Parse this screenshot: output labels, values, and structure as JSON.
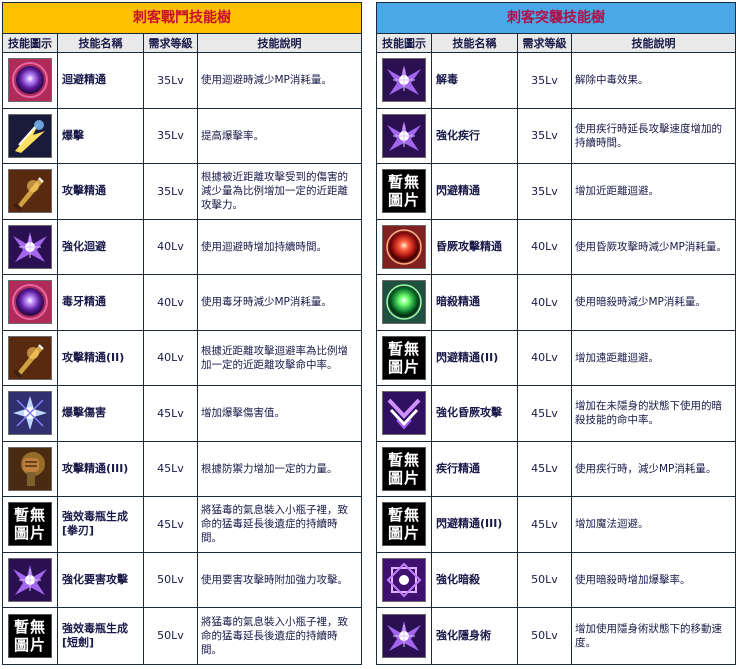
{
  "left": {
    "title": "刺客戰鬥技能樹",
    "headers": {
      "icon": "技能圖示",
      "name": "技能名稱",
      "level": "需求等級",
      "desc": "技能說明"
    },
    "rows": [
      {
        "icon": "purple-orb-icon",
        "name": "迴避精通",
        "level": "35Lv",
        "desc": "使用迴避時減少MP消耗量。"
      },
      {
        "icon": "lightning-strike-icon",
        "name": "爆擊",
        "level": "35Lv",
        "desc": "提高爆擊率。"
      },
      {
        "icon": "glowing-blade-icon",
        "name": "攻擊精通",
        "level": "35Lv",
        "desc": "根據被近距離攻擊受到的傷害的減少量為比例增加一定的近距離攻擊力。"
      },
      {
        "icon": "purple-wings-icon",
        "name": "強化迴避",
        "level": "40Lv",
        "desc": "使用迴避時增加持續時間。"
      },
      {
        "icon": "purple-orb-icon",
        "name": "毒牙精通",
        "level": "40Lv",
        "desc": "使用毒牙時減少MP消耗量。"
      },
      {
        "icon": "glowing-blade-icon",
        "name": "攻擊精通(II)",
        "level": "40Lv",
        "desc": "根據近距離攻擊迴避率為比例增加一定的近距離攻擊命中率。"
      },
      {
        "icon": "blue-burst-icon",
        "name": "爆擊傷害",
        "level": "45Lv",
        "desc": "增加爆擊傷害值。"
      },
      {
        "icon": "fist-icon",
        "name": "攻擊精通(III)",
        "level": "45Lv",
        "desc": "根據防禦力增加一定的力量。"
      },
      {
        "icon": "no-image",
        "noimg": "暫無圖片",
        "name": "強效毒瓶生成[拳刃]",
        "level": "45Lv",
        "desc": "將猛毒的氣息裝入小瓶子裡，致命的猛毒延長後遺症的持續時間。"
      },
      {
        "icon": "purple-wings-icon",
        "name": "強化要害攻擊",
        "level": "50Lv",
        "desc": "使用要害攻擊時附加強力攻擊。"
      },
      {
        "icon": "no-image",
        "noimg": "暫無圖片",
        "name": "強效毒瓶生成[短劍]",
        "level": "50Lv",
        "desc": "將猛毒的氣息裝入小瓶子裡，致命的猛毒延長後遺症的持續時間。"
      }
    ]
  },
  "right": {
    "title": "刺客突襲技能樹",
    "headers": {
      "icon": "技能圖示",
      "name": "技能名稱",
      "level": "需求等級",
      "desc": "技能說明"
    },
    "rows": [
      {
        "icon": "purple-wings-icon",
        "name": "解毒",
        "level": "35Lv",
        "desc": "解除中毒效果。"
      },
      {
        "icon": "purple-wings-icon",
        "name": "強化疾行",
        "level": "35Lv",
        "desc": "使用疾行時延長攻擊速度增加的持續時間。"
      },
      {
        "icon": "no-image",
        "noimg": "暫無圖片",
        "name": "閃避精通",
        "level": "35Lv",
        "desc": "增加近距離迴避。"
      },
      {
        "icon": "red-orb-icon",
        "name": "昏厥攻擊精通",
        "level": "40Lv",
        "desc": "使用昏厥攻擊時減少MP消耗量。"
      },
      {
        "icon": "green-orb-icon",
        "name": "暗殺精通",
        "level": "40Lv",
        "desc": "使用暗殺時減少MP消耗量。"
      },
      {
        "icon": "no-image",
        "noimg": "暫無圖片",
        "name": "閃避精通(II)",
        "level": "40Lv",
        "desc": "增加遠距離迴避。"
      },
      {
        "icon": "purple-chevron-icon",
        "name": "強化昏厥攻擊",
        "level": "45Lv",
        "desc": "增加在未隱身的狀態下使用的暗殺技能的命中率。"
      },
      {
        "icon": "no-image",
        "noimg": "暫無圖片",
        "name": "疾行精通",
        "level": "45Lv",
        "desc": "使用疾行時，減少MP消耗量。"
      },
      {
        "icon": "no-image",
        "noimg": "暫無圖片",
        "name": "閃避精通(III)",
        "level": "45Lv",
        "desc": "增加魔法迴避。"
      },
      {
        "icon": "purple-emblem-icon",
        "name": "強化暗殺",
        "level": "50Lv",
        "desc": "使用暗殺時增加爆擊率。"
      },
      {
        "icon": "purple-wings-icon",
        "name": "強化隱身術",
        "level": "50Lv",
        "desc": "增加使用隱身術狀態下的移動速度。"
      }
    ]
  }
}
